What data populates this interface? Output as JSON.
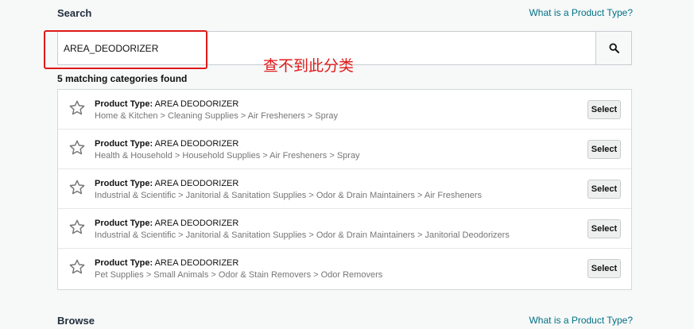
{
  "search": {
    "title": "Search",
    "help_link": "What is a Product Type?",
    "query": "AREA_DEODORIZER",
    "annotation": "查不到此分类",
    "match_count": "5 matching categories found"
  },
  "results": [
    {
      "type_label": "Product Type:",
      "type_value": "AREA DEODORIZER",
      "path": "Home & Kitchen > Cleaning Supplies > Air Fresheners > Spray",
      "select_label": "Select"
    },
    {
      "type_label": "Product Type:",
      "type_value": "AREA DEODORIZER",
      "path": "Health & Household > Household Supplies > Air Fresheners > Spray",
      "select_label": "Select"
    },
    {
      "type_label": "Product Type:",
      "type_value": "AREA DEODORIZER",
      "path": "Industrial & Scientific > Janitorial & Sanitation Supplies > Odor & Drain Maintainers > Air Fresheners",
      "select_label": "Select"
    },
    {
      "type_label": "Product Type:",
      "type_value": "AREA DEODORIZER",
      "path": "Industrial & Scientific > Janitorial & Sanitation Supplies > Odor & Drain Maintainers > Janitorial Deodorizers",
      "select_label": "Select"
    },
    {
      "type_label": "Product Type:",
      "type_value": "AREA DEODORIZER",
      "path": "Pet Supplies > Small Animals > Odor & Stain Removers > Odor Removers",
      "select_label": "Select"
    }
  ],
  "browse": {
    "title": "Browse",
    "help_link": "What is a Product Type?"
  },
  "colors": {
    "link": "#007185",
    "annotation_red": "#e01919"
  }
}
